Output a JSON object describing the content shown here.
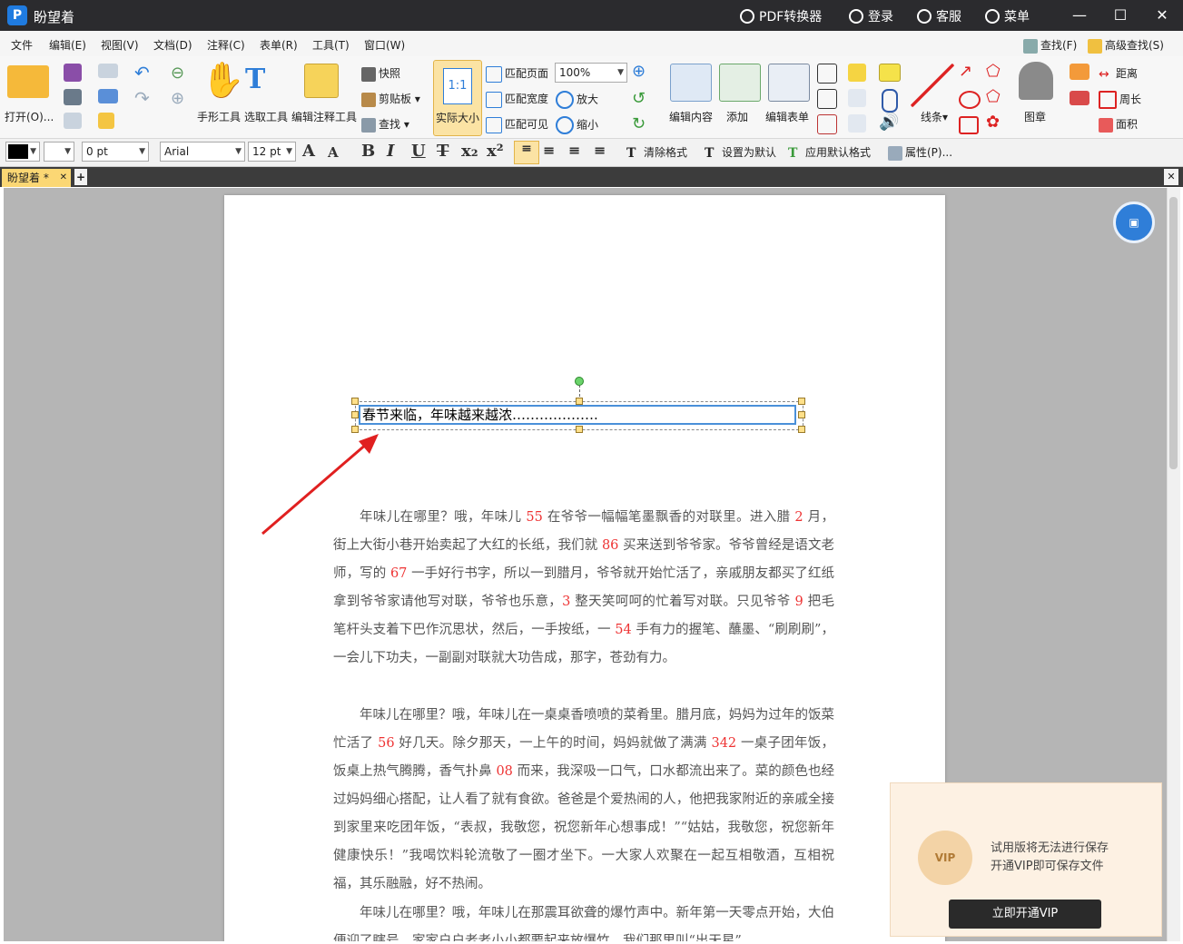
{
  "app": {
    "title": "盼望着"
  },
  "titlebar": {
    "pdf_converter": "PDF转换器",
    "login": "登录",
    "service": "客服",
    "menu": "菜单"
  },
  "menubar": [
    "文件",
    "编辑(E)",
    "视图(V)",
    "文档(D)",
    "注释(C)",
    "表单(R)",
    "工具(T)",
    "窗口(W)"
  ],
  "menubar_right": {
    "find": "查找(F)",
    "advanced_find": "高级查找(S)"
  },
  "ribbon": {
    "open": "打开(O)...",
    "hand_tool": "手形工具",
    "select_tool": "选取工具",
    "edit_annot_tool": "编辑注释工具",
    "snapshot": "快照",
    "clipboard": "剪贴板",
    "find": "查找",
    "actual_size": "实际大小",
    "actual_size_glyph": "1:1",
    "fit_page": "匹配页面",
    "fit_width": "匹配宽度",
    "fit_visible": "匹配可见",
    "zoom_value": "100%",
    "zoom_in": "放大",
    "zoom_out": "缩小",
    "edit_content": "编辑内容",
    "add": "添加",
    "edit_form": "编辑表单",
    "line": "线条",
    "stamp": "图章",
    "distance": "距离",
    "perimeter": "周长",
    "area": "面积"
  },
  "format": {
    "stroke_width": "0 pt",
    "font": "Arial",
    "font_size": "12 pt",
    "clear_format": "清除格式",
    "set_default": "设置为默认",
    "apply_default": "应用默认格式",
    "properties": "属性(P)..."
  },
  "tab": {
    "name": "盼望着 *"
  },
  "document": {
    "selected_text": "春节来临，年味越来越浓……………….",
    "paragraphs": [
      [
        {
          "t": "年味儿在哪里？哦，年味儿 "
        },
        {
          "t": "55",
          "r": true
        },
        {
          "t": " 在爷爷一幅幅笔墨飘香的对联里。进入腊 "
        },
        {
          "t": "2",
          "r": true
        },
        {
          "t": " 月，街上大街小巷开始卖起了大红的长纸，我们就 "
        },
        {
          "t": "86",
          "r": true
        },
        {
          "t": " 买来送到爷爷家。爷爷曾经是语文老师，写的 "
        },
        {
          "t": "67",
          "r": true
        },
        {
          "t": " 一手好行书字，所以一到腊月，爷爷就开始忙活了，亲戚朋友都买了红纸拿到爷爷家请他写对联，爷爷也乐意，"
        },
        {
          "t": "3",
          "r": true
        },
        {
          "t": " 整天笑呵呵的忙着写对联。只见爷爷 "
        },
        {
          "t": "9",
          "r": true
        },
        {
          "t": " 把毛笔杆头支着下巴作沉思状，然后，一手按纸，一 "
        },
        {
          "t": "54",
          "r": true
        },
        {
          "t": " 手有力的握笔、蘸墨、“刷刷刷”，一会儿下功夫，一副副对联就大功告成，那字，苍劲有力。"
        }
      ],
      [
        {
          "t": "年味儿在哪里？哦，年味儿在一桌桌香喷喷的菜肴里。腊月底，妈妈为过年的饭菜忙活了 "
        },
        {
          "t": "56",
          "r": true
        },
        {
          "t": " 好几天。除夕那天，一上午的时间，妈妈就做了满满 "
        },
        {
          "t": "342",
          "r": true
        },
        {
          "t": " 一桌子团年饭，饭桌上热气腾腾，香气扑鼻 "
        },
        {
          "t": "08",
          "r": true
        },
        {
          "t": " 而来，我深吸一口气，口水都流出来了。菜的颜色也经过妈妈细心搭配，让人看了就有食欲。爸爸是个爱热闹的人，他把我家附近的亲戚全接到家里来吃团年饭，“表叔，我敬您，祝您新年心想事成！”“姑姑，我敬您，祝您新年健康快乐！”我喝饮料轮流敬了一圈才坐下。一大家人欢聚在一起互相敬酒，互相祝福，其乐融融，好不热闹。"
        }
      ],
      [
        {
          "t": "年味儿在哪里？哦，年味儿在那震耳欲聋的爆竹声中。新年第一天零点开始，大伯便迎了瞎号，家家户户老老小小都要起来放爆竹，我们那里叫“出天星”"
        }
      ]
    ]
  },
  "vip_popup": {
    "line1": "试用版将无法进行保存",
    "line2": "开通VIP即可保存文件",
    "button": "立即开通VIP",
    "badge": "VIP"
  },
  "colors": {
    "titlebar": "#2b2b2e",
    "accent": "#2f7ed8",
    "highlight": "#e33333"
  }
}
